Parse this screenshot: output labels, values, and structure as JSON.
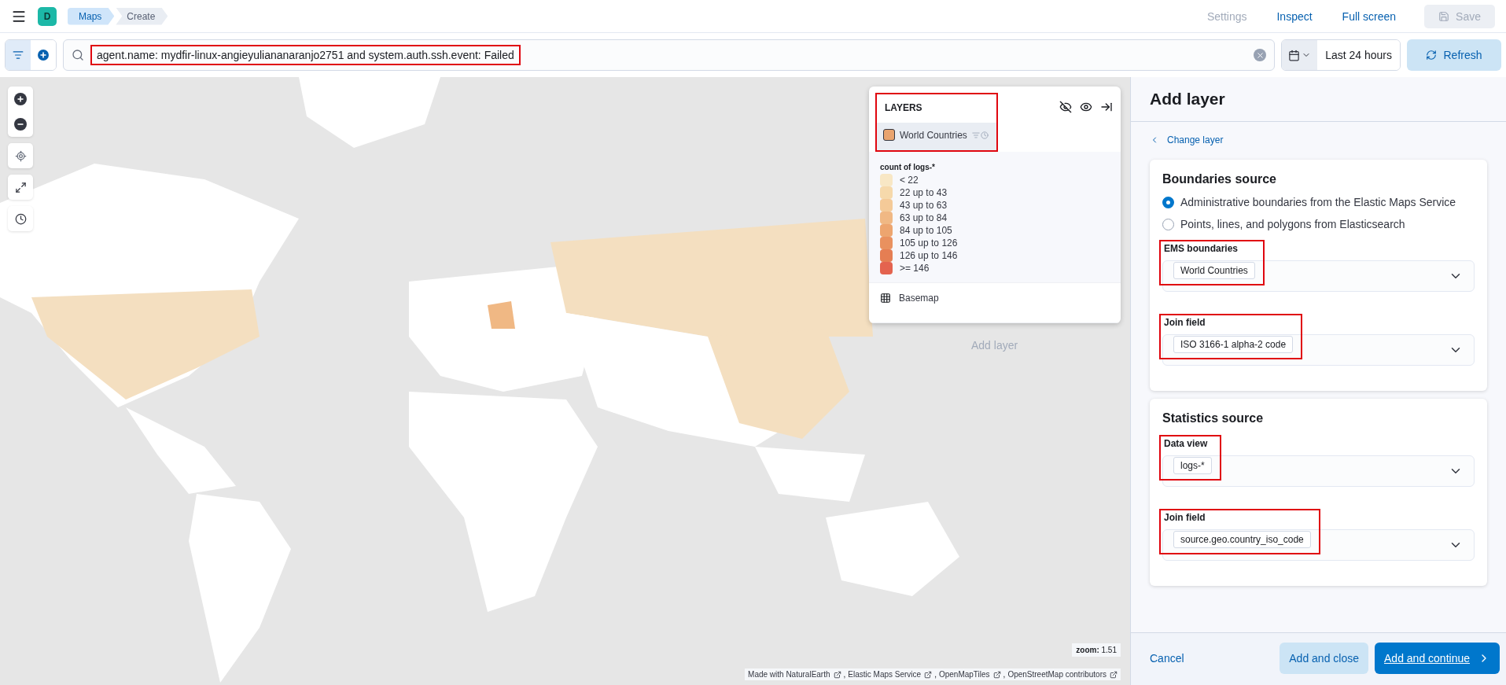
{
  "header": {
    "avatar": "D",
    "breadcrumbs": [
      {
        "label": "Maps",
        "selected": false
      },
      {
        "label": "Create",
        "selected": true
      }
    ],
    "actions": [
      {
        "label": "Settings",
        "disabled": true
      },
      {
        "label": "Inspect",
        "disabled": false
      },
      {
        "label": "Full screen",
        "disabled": false
      }
    ],
    "save": {
      "label": "Save",
      "disabled": true
    }
  },
  "query": {
    "value": "agent.name: mydfir-linux-angieyuliananaranjo2751 and system.auth.ssh.event: Failed",
    "highlighted": true
  },
  "time": {
    "label": "Last 24 hours"
  },
  "refresh": "Refresh",
  "layers_panel": {
    "title": "LAYERS",
    "highlighted": true,
    "layers": [
      {
        "kind": "vector",
        "name": "World Countries",
        "color": "#e9a46f",
        "legend": {
          "title": "count of logs-*",
          "items": [
            {
              "label": "< 22",
              "color": "#f8e7c5"
            },
            {
              "label": "22 up to 43",
              "color": "#f6d9ab"
            },
            {
              "label": "43 up to 63",
              "color": "#f4ca98"
            },
            {
              "label": "63 up to 84",
              "color": "#f0b884"
            },
            {
              "label": "84 up to 105",
              "color": "#eda56f"
            },
            {
              "label": "105 up to 126",
              "color": "#e9915f"
            },
            {
              "label": "126 up to 146",
              "color": "#e57e53"
            },
            {
              "label": ">= 146",
              "color": "#e4634f"
            }
          ]
        }
      },
      {
        "kind": "basemap",
        "name": "Basemap"
      }
    ]
  },
  "map": {
    "ghost_label": "Add layer",
    "zoom_label": "zoom:",
    "zoom_value": "1.51",
    "separator": ",",
    "attributions": [
      "Made with NaturalEarth",
      "Elastic Maps Service",
      "OpenMapTiles",
      "OpenStreetMap contributors"
    ]
  },
  "panel": {
    "title": "Add layer",
    "back_link": "Change layer",
    "sections": [
      {
        "title": "Boundaries source",
        "options": [
          {
            "label": "Administrative boundaries from the Elastic Maps Service",
            "selected": true
          },
          {
            "label": "Points, lines, and polygons from Elasticsearch",
            "selected": false
          }
        ],
        "fields": [
          {
            "label": "EMS boundaries",
            "value": "World Countries",
            "highlighted": true
          },
          {
            "label": "Join field",
            "value": "ISO 3166-1 alpha-2 code",
            "highlighted": true
          }
        ]
      },
      {
        "title": "Statistics source",
        "fields": [
          {
            "label": "Data view",
            "value": "logs-*",
            "highlighted": true
          },
          {
            "label": "Join field",
            "value": "source.geo.country_iso_code",
            "highlighted": true
          }
        ]
      }
    ],
    "footer": {
      "cancel": "Cancel",
      "secondary": "Add and close",
      "primary": "Add and continue"
    }
  }
}
